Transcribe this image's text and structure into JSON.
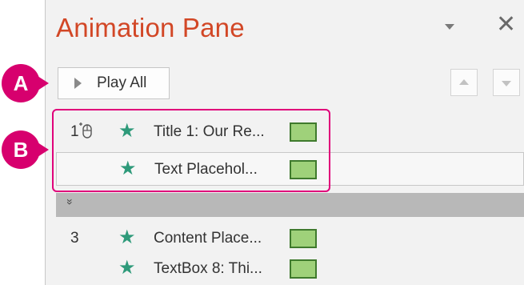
{
  "pane": {
    "title": "Animation Pane",
    "menu_icon": "chevron-down-icon",
    "close_glyph": "✕"
  },
  "toolbar": {
    "play_all_label": "Play All",
    "move_up_icon": "triangle-up-icon",
    "move_down_icon": "triangle-down-icon"
  },
  "rows": [
    {
      "number": "1",
      "trigger_icon": "mouse-click-icon",
      "effect_icon": "star-icon",
      "label": "Title 1: Our Re...",
      "effect_color": "#9fd17a"
    },
    {
      "number": "",
      "effect_icon": "star-icon",
      "label": "Text Placehol...",
      "effect_color": "#9fd17a"
    },
    {
      "number": "3",
      "effect_icon": "star-icon",
      "label": "Content Place...",
      "effect_color": "#9fd17a"
    },
    {
      "number": "",
      "effect_icon": "star-icon",
      "label": "TextBox 8: Thi...",
      "effect_color": "#9fd17a"
    }
  ],
  "expand": {
    "glyph": "»"
  },
  "callouts": {
    "a": "A",
    "b": "B",
    "color": "#d7006e"
  },
  "colors": {
    "title": "#d24726",
    "star": "#2e9a7a",
    "highlight": "#e0007a"
  }
}
